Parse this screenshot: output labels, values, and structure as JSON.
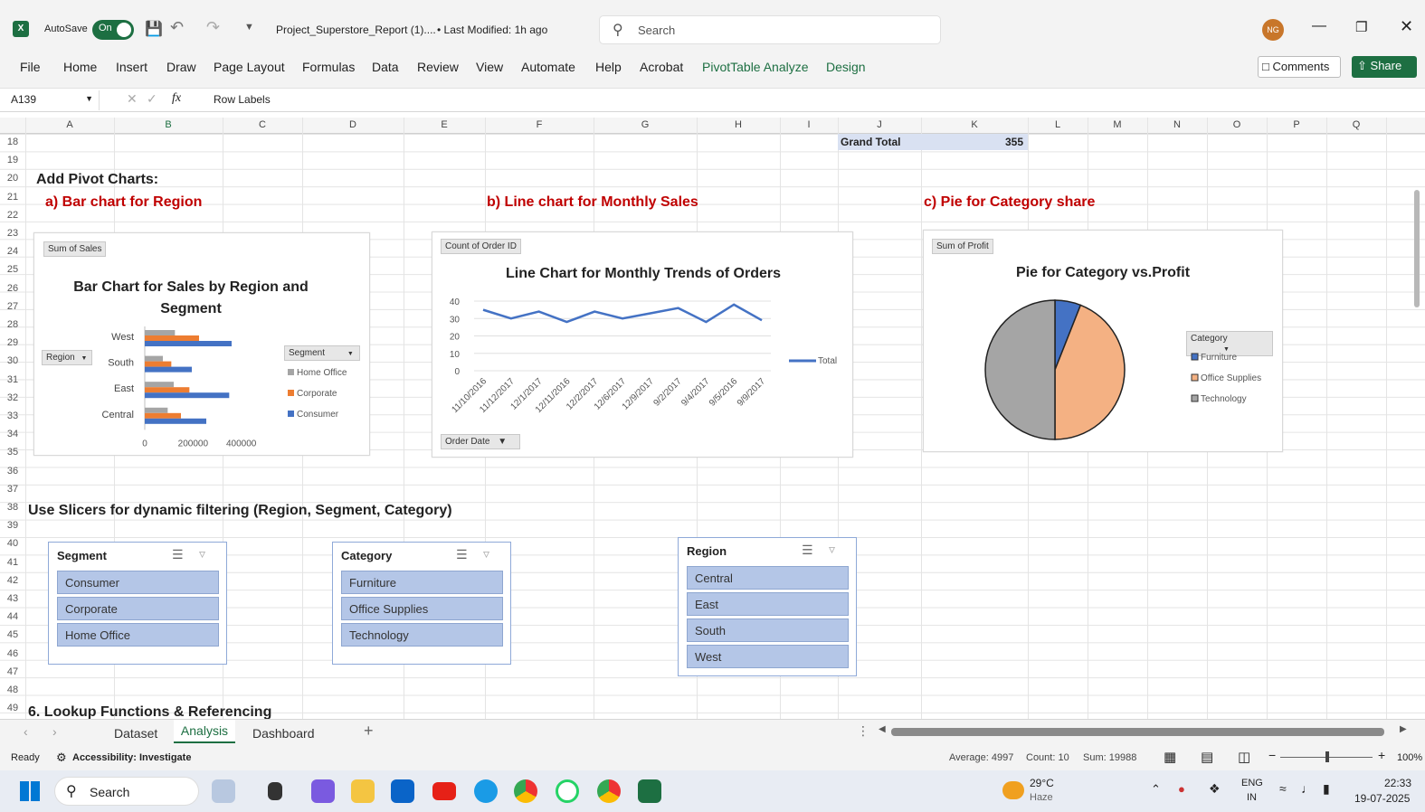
{
  "titlebar": {
    "app_icon": "excel-icon",
    "autosave_label": "AutoSave",
    "autosave_state": "On",
    "file_title": "Project_Superstore_Report (1)....",
    "modified": "• Last Modified: 1h ago",
    "search_placeholder": "Search",
    "avatar": "NG"
  },
  "menu": [
    "File",
    "Home",
    "Insert",
    "Draw",
    "Page Layout",
    "Formulas",
    "Data",
    "Review",
    "View",
    "Automate",
    "Help",
    "Acrobat",
    "PivotTable Analyze",
    "Design"
  ],
  "buttons": {
    "comments": "Comments",
    "share": "Share"
  },
  "formula": {
    "cell_ref": "A139",
    "fx": "fx",
    "content": "Row Labels"
  },
  "columns": [
    "A",
    "B",
    "C",
    "D",
    "E",
    "F",
    "G",
    "H",
    "I",
    "J",
    "K",
    "L",
    "M",
    "N",
    "O",
    "P",
    "Q"
  ],
  "rows": [
    "18",
    "19",
    "20",
    "21",
    "22",
    "23",
    "24",
    "25",
    "26",
    "27",
    "28",
    "29",
    "30",
    "31",
    "32",
    "33",
    "34",
    "35",
    "36",
    "37",
    "38",
    "39",
    "40",
    "41",
    "42",
    "43",
    "44",
    "45",
    "46",
    "47",
    "48",
    "49"
  ],
  "cells": {
    "grand_total_label": "Grand Total",
    "grand_total_value": "355",
    "add_pivot": "Add Pivot Charts:",
    "bar_heading": "a) Bar chart for Region",
    "line_heading": "b) Line chart for Monthly Sales",
    "pie_heading": "c) Pie for Category share",
    "slicers_heading": "Use Slicers for dynamic filtering (Region, Segment, Category)",
    "lookup_heading": "6. Lookup Functions & Referencing"
  },
  "bar_card": {
    "field": "Sum of Sales",
    "row_field": "Region",
    "legend_field": "Segment"
  },
  "line_card": {
    "field": "Count of Order ID",
    "axis_field": "Order Date"
  },
  "pie_card": {
    "field": "Sum of Profit",
    "legend_field": "Category"
  },
  "chart_data": [
    {
      "type": "bar",
      "title": "Bar Chart for Sales by Region and Segment",
      "categories": [
        "West",
        "South",
        "East",
        "Central"
      ],
      "series": [
        {
          "name": "Home Office",
          "color": "#a5a5a5",
          "values": [
            125000,
            75000,
            120000,
            95000
          ]
        },
        {
          "name": "Corporate",
          "color": "#ed7d31",
          "values": [
            225000,
            110000,
            185000,
            150000
          ]
        },
        {
          "name": "Consumer",
          "color": "#4472c4",
          "values": [
            360000,
            195000,
            350000,
            255000
          ]
        }
      ],
      "xticks": [
        "0",
        "200000",
        "400000"
      ],
      "xlim": [
        0,
        450000
      ]
    },
    {
      "type": "line",
      "title": "Line Chart for Monthly Trends of Orders",
      "categories": [
        "11/10/2016",
        "11/12/2017",
        "12/1/2017",
        "12/11/2016",
        "12/2/2017",
        "12/6/2017",
        "12/9/2017",
        "9/2/2017",
        "9/4/2017",
        "9/5/2016",
        "9/9/2017"
      ],
      "series": [
        {
          "name": "Total",
          "color": "#4472c4",
          "values": [
            35,
            30,
            34,
            28,
            34,
            30,
            33,
            36,
            28,
            38,
            29
          ]
        }
      ],
      "yticks": [
        "0",
        "10",
        "20",
        "30",
        "40"
      ],
      "ylim": [
        0,
        40
      ]
    },
    {
      "type": "pie",
      "title": "Pie for Category vs.Profit",
      "series": [
        {
          "name": "Furniture",
          "color": "#4472c4",
          "value": 6
        },
        {
          "name": "Office Supplies",
          "color": "#f4b183",
          "value": 44
        },
        {
          "name": "Technology",
          "color": "#a5a5a5",
          "value": 50
        }
      ]
    }
  ],
  "slicers": [
    {
      "title": "Segment",
      "items": [
        "Consumer",
        "Corporate",
        "Home Office"
      ]
    },
    {
      "title": "Category",
      "items": [
        "Furniture",
        "Office Supplies",
        "Technology"
      ]
    },
    {
      "title": "Region",
      "items": [
        "Central",
        "East",
        "South",
        "West"
      ]
    }
  ],
  "sheets": [
    "Dataset",
    "Analysis",
    "Dashboard"
  ],
  "active_sheet": "Analysis",
  "status": {
    "ready": "Ready",
    "accessibility": "Accessibility: Investigate",
    "average": "Average: 4997",
    "count": "Count: 10",
    "sum": "Sum: 19988",
    "zoom": "100%"
  },
  "taskbar": {
    "search": "Search",
    "weather_temp": "29°C",
    "weather_desc": "Haze",
    "lang": "ENG",
    "region": "IN",
    "time": "22:33",
    "date": "19-07-2025"
  }
}
